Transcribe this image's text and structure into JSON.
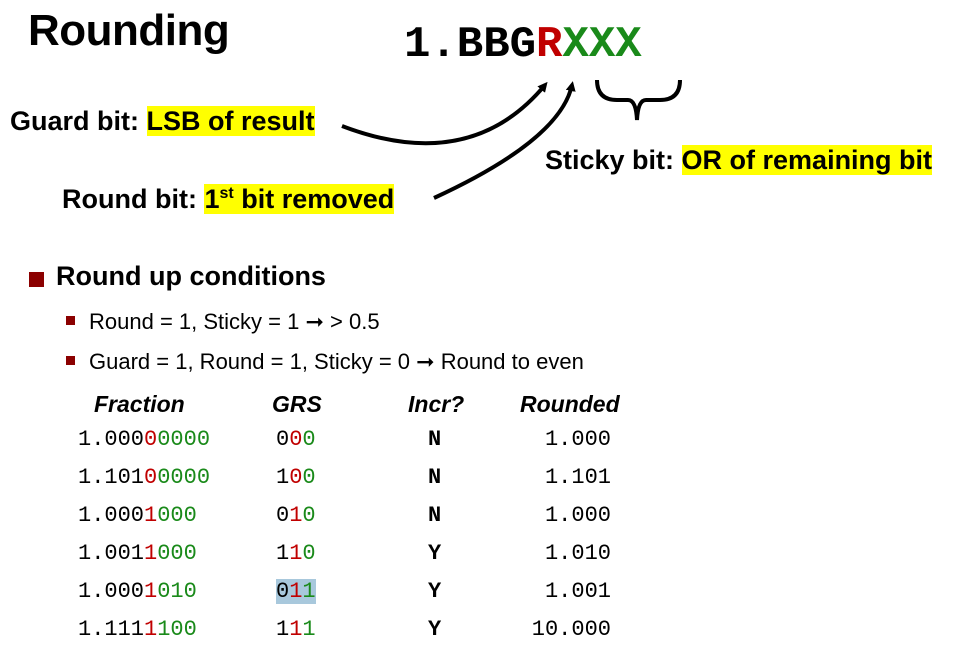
{
  "title": "Rounding",
  "bits": {
    "prefix": "1.BBG",
    "round": "R",
    "sticky": "XXX"
  },
  "guard": {
    "label": "Guard bit: ",
    "desc": "LSB of result"
  },
  "round": {
    "label": "Round bit: ",
    "desc_num": "1",
    "desc_sup": "st",
    "desc_rest": " bit removed"
  },
  "sticky": {
    "label": "Sticky bit: ",
    "desc": "OR of remaining bit"
  },
  "conditions": {
    "heading": "Round up conditions",
    "items": [
      {
        "left": "Round = 1, Sticky = 1 ",
        "arrow": "➞",
        "right": " > 0.5"
      },
      {
        "left": "Guard = 1, Round = 1, Sticky = 0 ",
        "arrow": "➞",
        "right": " Round to even"
      }
    ]
  },
  "table": {
    "headers": [
      "Fraction",
      "GRS",
      "Incr?",
      "Rounded"
    ],
    "rows": [
      {
        "f_pre": "1.000",
        "f_g": "0",
        "f_r": "0",
        "f_s": "000",
        "grs_g": "0",
        "grs_r": "0",
        "grs_s": "0",
        "incr": "N",
        "rounded": "1.000"
      },
      {
        "f_pre": "1.101",
        "f_g": "0",
        "f_r": "0",
        "f_s": "000",
        "grs_g": "1",
        "grs_r": "0",
        "grs_s": "0",
        "incr": "N",
        "rounded": "1.101"
      },
      {
        "f_pre": "1.000",
        "f_g": "1",
        "f_r": "0",
        "f_s": "00",
        "grs_g": "0",
        "grs_r": "1",
        "grs_s": "0",
        "incr": "N",
        "rounded": "1.000"
      },
      {
        "f_pre": "1.001",
        "f_g": "1",
        "f_r": "0",
        "f_s": "00",
        "grs_g": "1",
        "grs_r": "1",
        "grs_s": "0",
        "incr": "Y",
        "rounded": "1.010"
      },
      {
        "f_pre": "1.000",
        "f_g": "1",
        "f_r": "0",
        "f_s": "10",
        "grs_g": "0",
        "grs_r": "1",
        "grs_s": "1",
        "incr": "Y",
        "rounded": "1.001"
      },
      {
        "f_pre": "1.111",
        "f_g": "1",
        "f_r": "1",
        "f_s": "00",
        "grs_g": "1",
        "grs_r": "1",
        "grs_s": "1",
        "incr": "Y",
        "rounded": "10.000"
      }
    ]
  }
}
